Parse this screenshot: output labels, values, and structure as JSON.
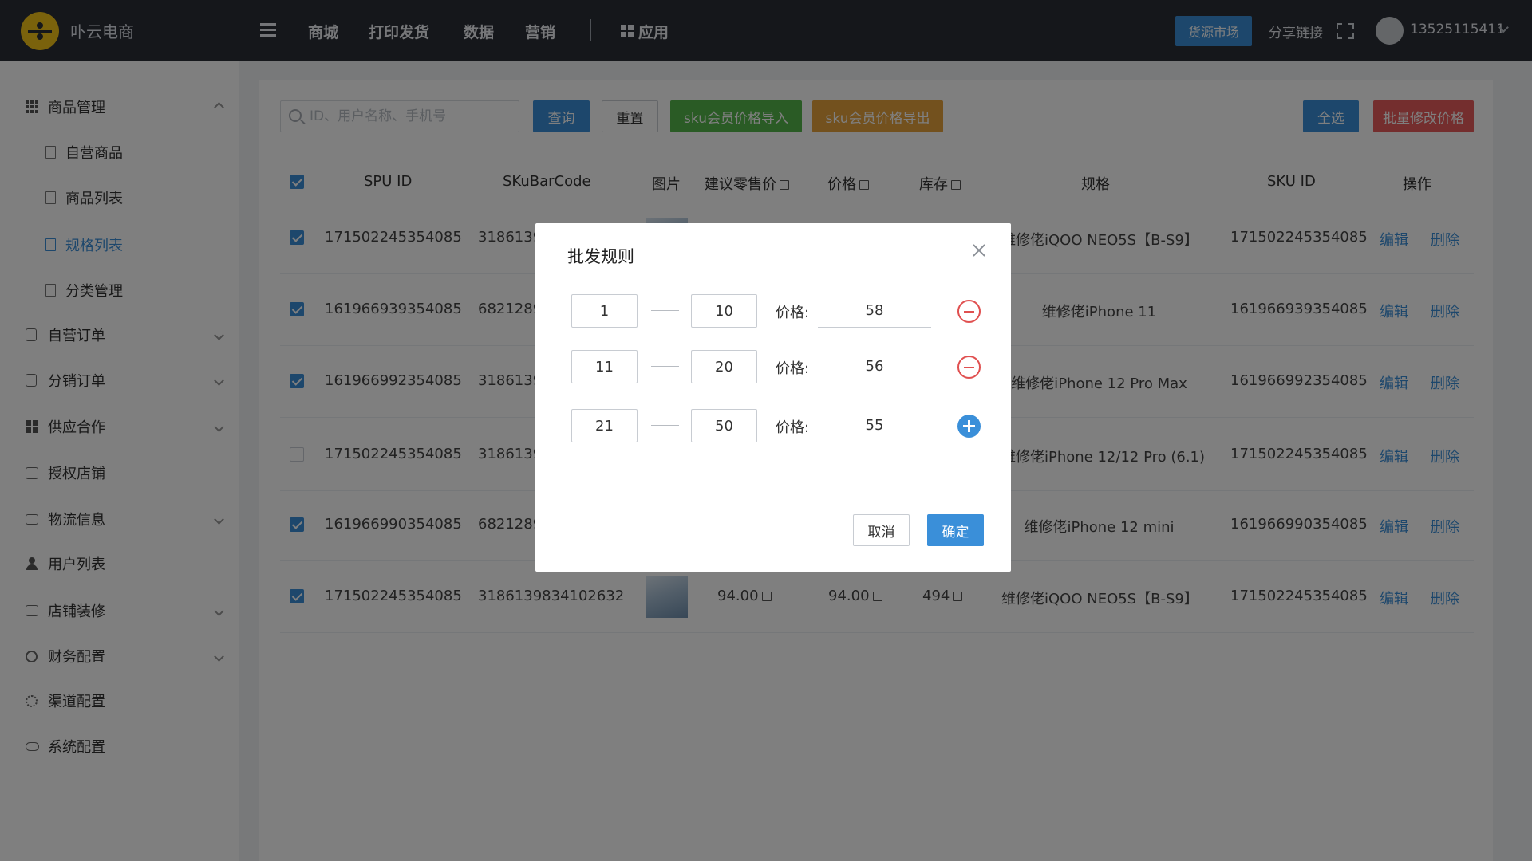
{
  "header": {
    "app_name": "卟云电商",
    "nav": [
      "商城",
      "打印发货",
      "数据",
      "营销"
    ],
    "apps_label": "应用",
    "market_button": "货源市场",
    "share_link": "分享链接",
    "username": "13525115411"
  },
  "sidebar": {
    "items": [
      {
        "label": "商品管理"
      },
      {
        "label": "自营商品"
      },
      {
        "label": "商品列表"
      },
      {
        "label": "规格列表"
      },
      {
        "label": "分类管理"
      },
      {
        "label": "自营订单"
      },
      {
        "label": "分销订单"
      },
      {
        "label": "供应合作"
      },
      {
        "label": "授权店铺"
      },
      {
        "label": "物流信息"
      },
      {
        "label": "用户列表"
      },
      {
        "label": "店铺装修"
      },
      {
        "label": "财务配置"
      },
      {
        "label": "渠道配置"
      },
      {
        "label": "系统配置"
      }
    ]
  },
  "toolbar": {
    "search_placeholder": "ID、用户名称、手机号",
    "query": "查询",
    "reset": "重置",
    "import": "sku会员价格导入",
    "export": "sku会员价格导出",
    "select_all": "全选",
    "batch_edit": "批量修改价格"
  },
  "table": {
    "headers": [
      "SPU ID",
      "SKuBarCode",
      "图片",
      "建议零售价",
      "价格",
      "库存",
      "规格",
      "SKU ID",
      "操作"
    ],
    "edit_label": "编辑",
    "delete_label": "删除",
    "rows": [
      {
        "checked": true,
        "spu": "171502245354085",
        "barcode": "3186139",
        "retail": "",
        "price": "",
        "stock": "",
        "spec": "维修佬iQOO NEO5S【B-S9】",
        "sku": "171502245354085"
      },
      {
        "checked": true,
        "spu": "161966939354085",
        "barcode": "6821289",
        "retail": "",
        "price": "",
        "stock": "",
        "spec": "维修佬iPhone 11",
        "sku": "161966939354085"
      },
      {
        "checked": true,
        "spu": "161966992354085",
        "barcode": "3186139",
        "retail": "",
        "price": "",
        "stock": "",
        "spec": "维修佬iPhone 12 Pro Max",
        "sku": "161966992354085"
      },
      {
        "checked": false,
        "spu": "171502245354085",
        "barcode": "3186139",
        "retail": "",
        "price": "",
        "stock": "",
        "spec": "维修佬iPhone 12/12 Pro (6.1)",
        "sku": "171502245354085"
      },
      {
        "checked": true,
        "spu": "161966990354085",
        "barcode": "6821289",
        "retail": "",
        "price": "",
        "stock": "",
        "spec": "维修佬iPhone 12 mini",
        "sku": "161966990354085"
      },
      {
        "checked": true,
        "spu": "171502245354085",
        "barcode": "3186139834102632",
        "retail": "94.00",
        "price": "94.00",
        "stock": "494",
        "spec": "维修佬iQOO NEO5S【B-S9】",
        "sku": "171502245354085"
      }
    ]
  },
  "dialog": {
    "title": "批发规则",
    "price_label": "价格:",
    "rules": [
      {
        "from": "1",
        "to": "10",
        "price": "58",
        "action": "remove"
      },
      {
        "from": "11",
        "to": "20",
        "price": "56",
        "action": "remove"
      },
      {
        "from": "21",
        "to": "50",
        "price": "55",
        "action": "add"
      }
    ],
    "cancel": "取消",
    "confirm": "确定"
  }
}
